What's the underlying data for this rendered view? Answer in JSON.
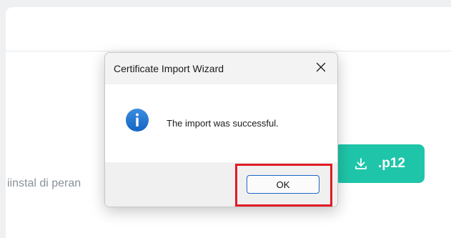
{
  "background": {
    "partial_text": "iinstal di peran",
    "download_button": {
      "label": ".p12",
      "icon": "download-icon",
      "color": "#1fc5a9"
    }
  },
  "dialog": {
    "title": "Certificate Import Wizard",
    "close_icon": "close-icon",
    "message": "The import was successful.",
    "message_icon": "info-icon",
    "ok_label": "OK"
  },
  "annotation": {
    "highlight_color": "#e11b24",
    "target": "ok-button"
  }
}
